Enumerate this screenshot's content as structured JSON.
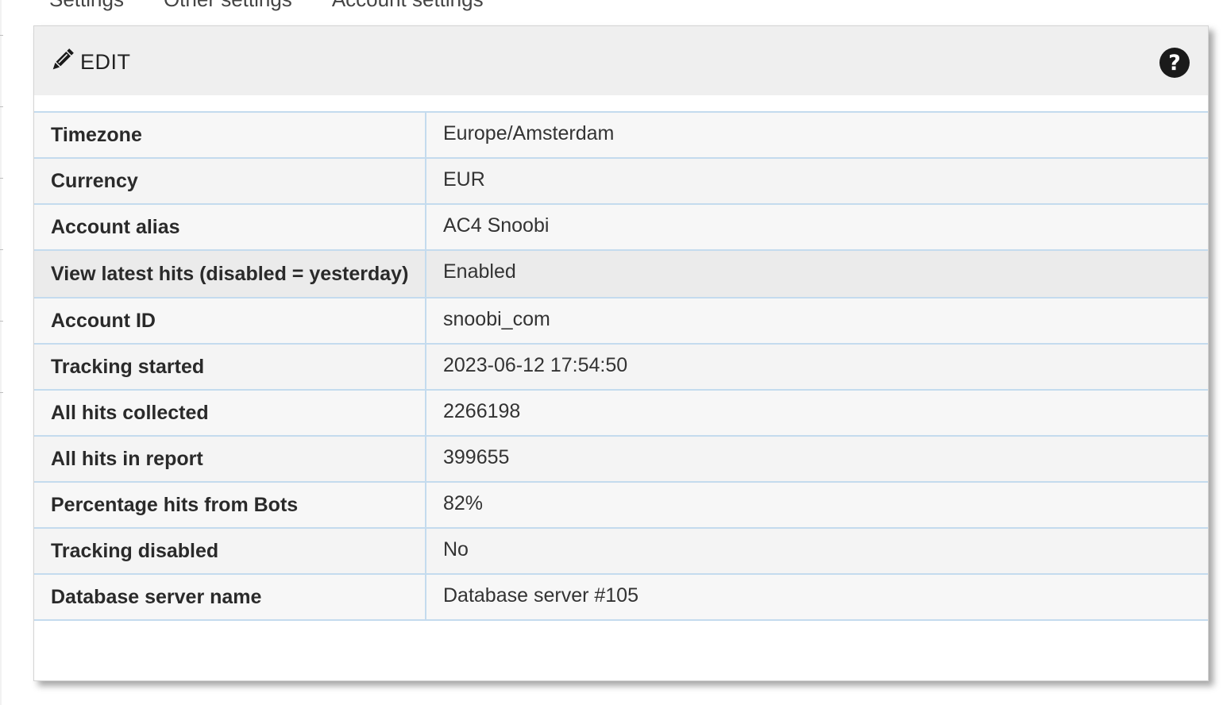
{
  "breadcrumb": {
    "items": [
      "Settings",
      "Other settings",
      "Account settings"
    ]
  },
  "panel": {
    "edit_label": "EDIT",
    "edit_icon": "pencil-icon",
    "help_icon": "question-circle-icon"
  },
  "settings": {
    "rows": [
      {
        "label": "Timezone",
        "value": "Europe/Amsterdam"
      },
      {
        "label": "Currency",
        "value": "EUR"
      },
      {
        "label": "Account alias",
        "value": "AC4 Snoobi"
      },
      {
        "label": "View latest hits (disabled = yesterday)",
        "value": "Enabled"
      },
      {
        "label": "Account ID",
        "value": "snoobi_com"
      },
      {
        "label": "Tracking started",
        "value": "2023-06-12 17:54:50"
      },
      {
        "label": "All hits collected",
        "value": "2266198"
      },
      {
        "label": "All hits in report",
        "value": "399655"
      },
      {
        "label": "Percentage hits from Bots",
        "value": "82%"
      },
      {
        "label": "Tracking disabled",
        "value": "No"
      },
      {
        "label": "Database server name",
        "value": "Database server #105"
      }
    ]
  },
  "colors": {
    "header_bg": "#efefef",
    "row_border": "#c4dbee",
    "highlight_row": "#ebebeb"
  }
}
